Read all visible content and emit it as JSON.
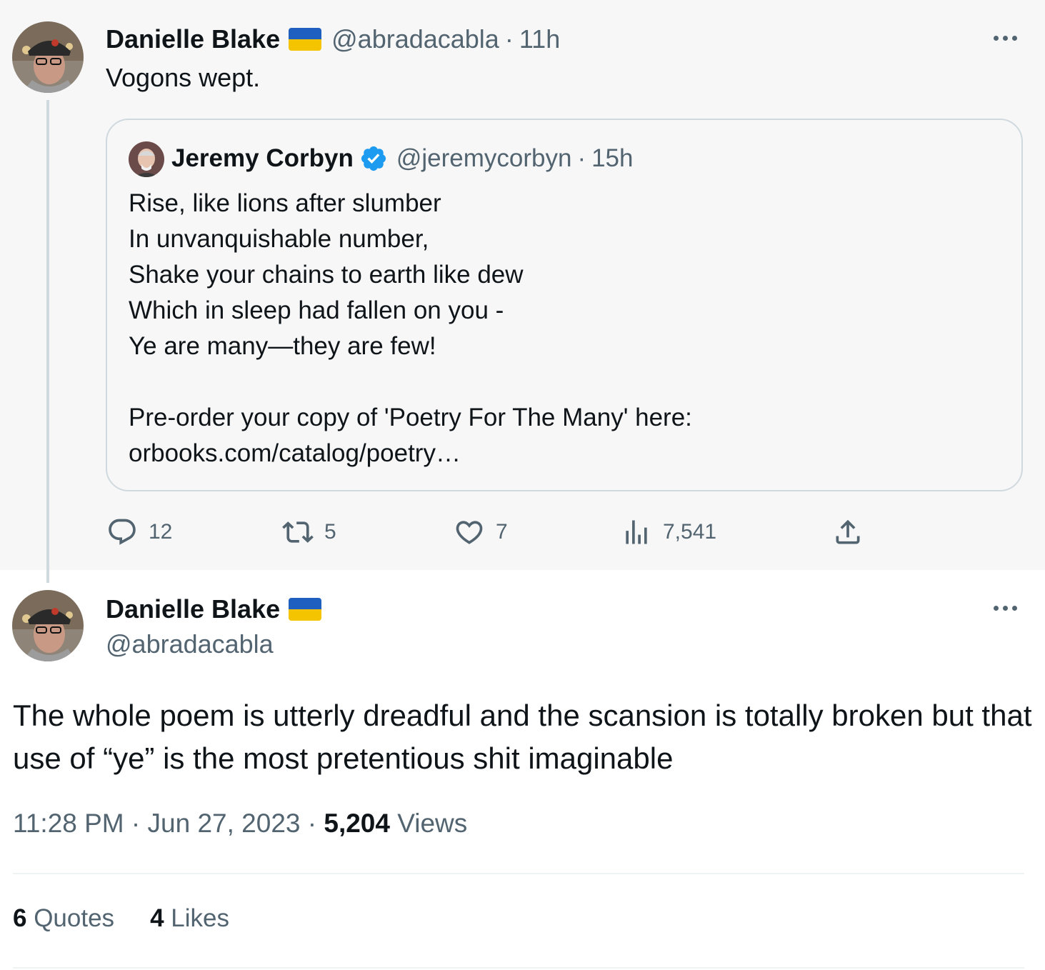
{
  "parent": {
    "author": "Danielle Blake",
    "handle": "@abradacabla",
    "separator": "·",
    "time": "11h",
    "text": "Vogons wept.",
    "quote": {
      "author": "Jeremy Corbyn",
      "handle": "@jeremycorbyn",
      "separator": "·",
      "time": "15h",
      "lines": [
        "Rise, like lions after slumber",
        "In unvanquishable number,",
        "Shake your chains to earth like dew",
        "Which in sleep had fallen on you -",
        "Ye are many—they are few!",
        "",
        "Pre-order your copy of 'Poetry For The Many' here:",
        "orbooks.com/catalog/poetry…"
      ]
    },
    "actions": {
      "replies": "12",
      "retweets": "5",
      "likes": "7",
      "views": "7,541"
    }
  },
  "main": {
    "author": "Danielle Blake",
    "handle": "@abradacabla",
    "text": "The whole poem is utterly dreadful and the scansion is totally broken but that use of “ye” is the most pretentious shit imaginable",
    "meta": {
      "time": "11:28 PM",
      "sep1": "·",
      "date": "Jun 27, 2023",
      "sep2": "·",
      "views_count": "5,204",
      "views_label": "Views"
    },
    "stats": {
      "quotes_count": "6",
      "quotes_label": "Quotes",
      "likes_count": "4",
      "likes_label": "Likes"
    }
  },
  "colors": {
    "text": "#0f1419",
    "secondary": "#536471",
    "border": "#cfd9de",
    "verified": "#1d9bf0",
    "flag_blue": "#1f5fbf",
    "flag_yellow": "#f5c400"
  },
  "icons": [
    "more-icon",
    "ukraine-flag-icon",
    "verified-badge-icon",
    "reply-icon",
    "retweet-icon",
    "like-icon",
    "views-icon",
    "share-icon"
  ]
}
